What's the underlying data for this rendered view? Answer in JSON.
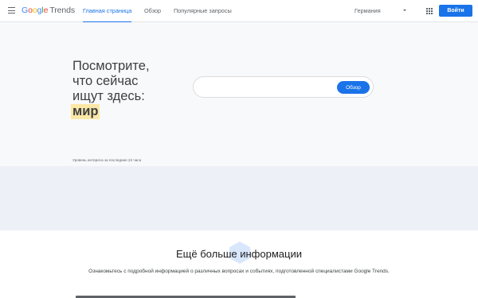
{
  "header": {
    "logo": {
      "google": [
        "G",
        "o",
        "o",
        "g",
        "l",
        "e"
      ],
      "product": "Trends"
    },
    "tabs": [
      {
        "label": "Главная страница",
        "active": true
      },
      {
        "label": "Обзор",
        "active": false
      },
      {
        "label": "Популярные запросы",
        "active": false
      }
    ],
    "country": "Германия",
    "login_label": "Войти",
    "icons": {
      "menu": "menu-icon",
      "apps": "apps-icon",
      "country": "chevron-down-icon"
    }
  },
  "hero": {
    "headline": [
      "Посмотрите,",
      "что сейчас",
      "ищут здесь:"
    ],
    "highlight_word": "мир",
    "search": {
      "value": "",
      "placeholder": "",
      "button_label": "Обзор"
    },
    "interest_label": "Уровень интереса за последние 24 часа"
  },
  "more_info": {
    "title": "Ещё больше информации",
    "description": "Ознакомьтесь с подробной информацией о различных вопросах и событиях, подготовленной специалистами Google Trends."
  },
  "colors": {
    "accent": "#1a73e8",
    "highlight": "#fde7a6",
    "hero_bg": "#f8f9fa",
    "band_bg": "#edf0f6"
  }
}
